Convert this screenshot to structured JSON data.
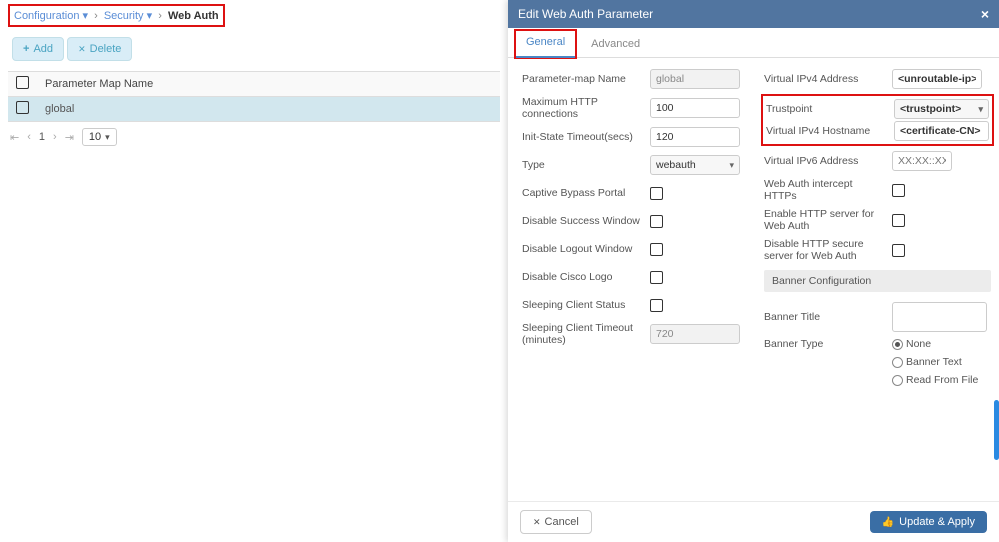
{
  "breadcrumb": {
    "items": [
      "Configuration",
      "Security",
      "Web Auth"
    ],
    "markers": [
      "▾",
      "▾",
      ""
    ]
  },
  "actions": {
    "add": "Add",
    "delete": "Delete"
  },
  "table": {
    "header": "Parameter Map Name",
    "rows": [
      {
        "name": "global"
      }
    ]
  },
  "pager": {
    "first": "⇤",
    "prev": "‹",
    "page": "1",
    "next": "›",
    "last": "⇥",
    "size": "10"
  },
  "panel": {
    "title": "Edit Web Auth Parameter",
    "tabs": {
      "general": "General",
      "advanced": "Advanced"
    },
    "left": {
      "param_name": {
        "label": "Parameter-map Name",
        "value": "global"
      },
      "max_http": {
        "label": "Maximum HTTP connections",
        "value": "100"
      },
      "init_to": {
        "label": "Init-State Timeout(secs)",
        "value": "120"
      },
      "type": {
        "label": "Type",
        "value": "webauth"
      },
      "captive": {
        "label": "Captive Bypass Portal"
      },
      "dis_succ": {
        "label": "Disable Success Window"
      },
      "dis_logout": {
        "label": "Disable Logout Window"
      },
      "dis_logo": {
        "label": "Disable Cisco Logo"
      },
      "sleep_stat": {
        "label": "Sleeping Client Status"
      },
      "sleep_to": {
        "label": "Sleeping Client Timeout (minutes)",
        "value": "720"
      }
    },
    "right": {
      "vip4": {
        "label": "Virtual IPv4 Address",
        "value": "<unroutable-ip>"
      },
      "trust": {
        "label": "Trustpoint",
        "value": "<trustpoint>"
      },
      "vip4host": {
        "label": "Virtual IPv4 Hostname",
        "value": "<certificate-CN>"
      },
      "vip6": {
        "label": "Virtual IPv6 Address",
        "placeholder": "XX:XX::XX"
      },
      "intercept": {
        "label": "Web Auth intercept HTTPs"
      },
      "en_http": {
        "label": "Enable HTTP server for Web Auth"
      },
      "dis_https": {
        "label": "Disable HTTP secure server for Web Auth"
      },
      "banner_hdr": "Banner Configuration",
      "banner_title_lbl": "Banner Title",
      "banner_type_lbl": "Banner Type",
      "radios": {
        "none": "None",
        "text": "Banner Text",
        "file": "Read From File"
      }
    },
    "footer": {
      "cancel": "Cancel",
      "apply": "Update & Apply"
    }
  }
}
